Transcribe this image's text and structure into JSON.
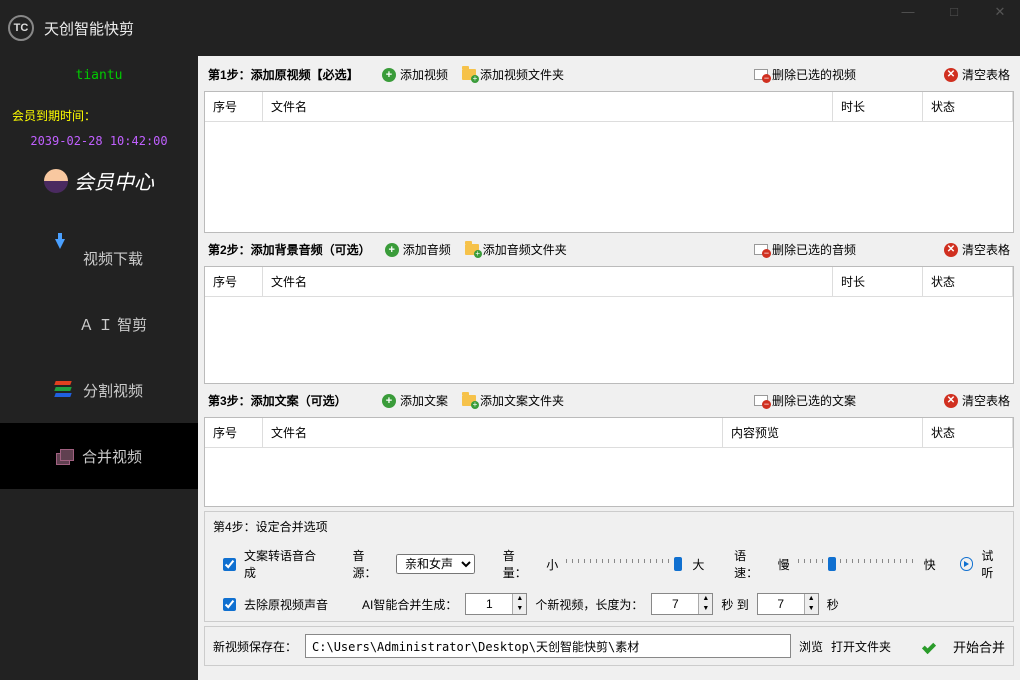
{
  "app": {
    "title": "天创智能快剪",
    "logo_text": "TC"
  },
  "window_controls": {
    "min": "—",
    "max": "□",
    "close": "✕"
  },
  "sidebar": {
    "brand": "tiantu",
    "expiry_label": "会员到期时间：",
    "expiry_date": "2039-02-28 10:42:00",
    "member_center": "会员中心",
    "nav": [
      {
        "label": "视频下载",
        "icon": "download-icon"
      },
      {
        "label": "Ａ Ｉ 智剪",
        "icon": "ai-icon"
      },
      {
        "label": "分割视频",
        "icon": "split-icon"
      },
      {
        "label": "合并视频",
        "icon": "merge-icon"
      }
    ],
    "active_index": 3
  },
  "steps": {
    "s1": {
      "label": "第1步：添加原视频【必选】",
      "add": "添加视频",
      "add_folder": "添加视频文件夹",
      "del_sel": "删除已选的视频",
      "clear": "清空表格",
      "cols": {
        "idx": "序号",
        "name": "文件名",
        "dur": "时长",
        "stat": "状态"
      }
    },
    "s2": {
      "label": "第2步：添加背景音频（可选）",
      "add": "添加音频",
      "add_folder": "添加音频文件夹",
      "del_sel": "删除已选的音频",
      "clear": "清空表格",
      "cols": {
        "idx": "序号",
        "name": "文件名",
        "dur": "时长",
        "stat": "状态"
      }
    },
    "s3": {
      "label": "第3步：添加文案（可选）",
      "add": "添加文案",
      "add_folder": "添加文案文件夹",
      "del_sel": "删除已选的文案",
      "clear": "清空表格",
      "cols": {
        "idx": "序号",
        "name": "文件名",
        "preview": "内容预览",
        "stat": "状态"
      }
    },
    "s4": {
      "label": "第4步：设定合并选项",
      "tts_checkbox": "文案转语音合成",
      "voice_label": "音源：",
      "voice_value": "亲和女声",
      "volume_label": "音量：",
      "volume_min": "小",
      "volume_max": "大",
      "speed_label": "语速：",
      "speed_min": "慢",
      "speed_max": "快",
      "preview": "试听",
      "remove_audio_checkbox": "去除原视频声音",
      "ai_merge_label": "AI智能合并生成：",
      "count_value": "1",
      "count_suffix": "个新视频，长度为：",
      "dur_from": "7",
      "dur_to_label": "秒 到",
      "dur_to": "7",
      "dur_unit": "秒"
    }
  },
  "output": {
    "save_label": "新视频保存在：",
    "path": "C:\\Users\\Administrator\\Desktop\\天创智能快剪\\素材",
    "browse": "浏览",
    "open_folder": "打开文件夹",
    "start": "开始合并"
  }
}
